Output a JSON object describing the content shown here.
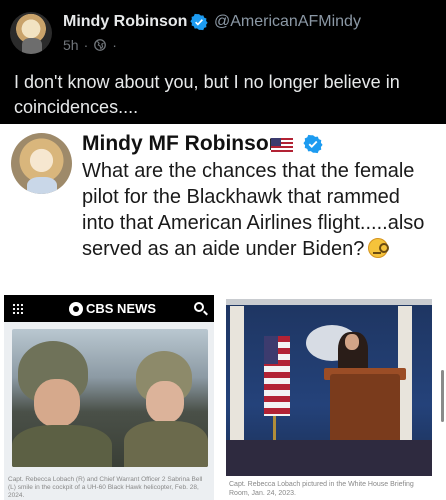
{
  "post": {
    "author_name": "Mindy Robinson",
    "author_handle": "@AmericanAFMindy",
    "time": "5h",
    "dot": "·",
    "text": "I don't know about you, but I no longer believe in coincidences....",
    "verified_color": "#1d9bf0"
  },
  "quoted": {
    "author_name": "Mindy MF Robinson",
    "text": "What are the chances that the female pilot for the Blackhawk that rammed into that American Airlines flight.....also served as an aide under Biden?",
    "emoji": "face-with-monocle"
  },
  "cbs_panel": {
    "logo_text": "CBS NEWS",
    "caption": "Capt. Rebecca Lobach (R) and Chief Warrant Officer 2 Sabrina Bell (L) smile in the cockpit of a UH-60 Black Hawk helicopter, Feb. 28, 2024."
  },
  "wh_panel": {
    "caption": "Capt. Rebecca Lobach pictured in the White House Briefing Room, Jan. 24, 2023."
  }
}
